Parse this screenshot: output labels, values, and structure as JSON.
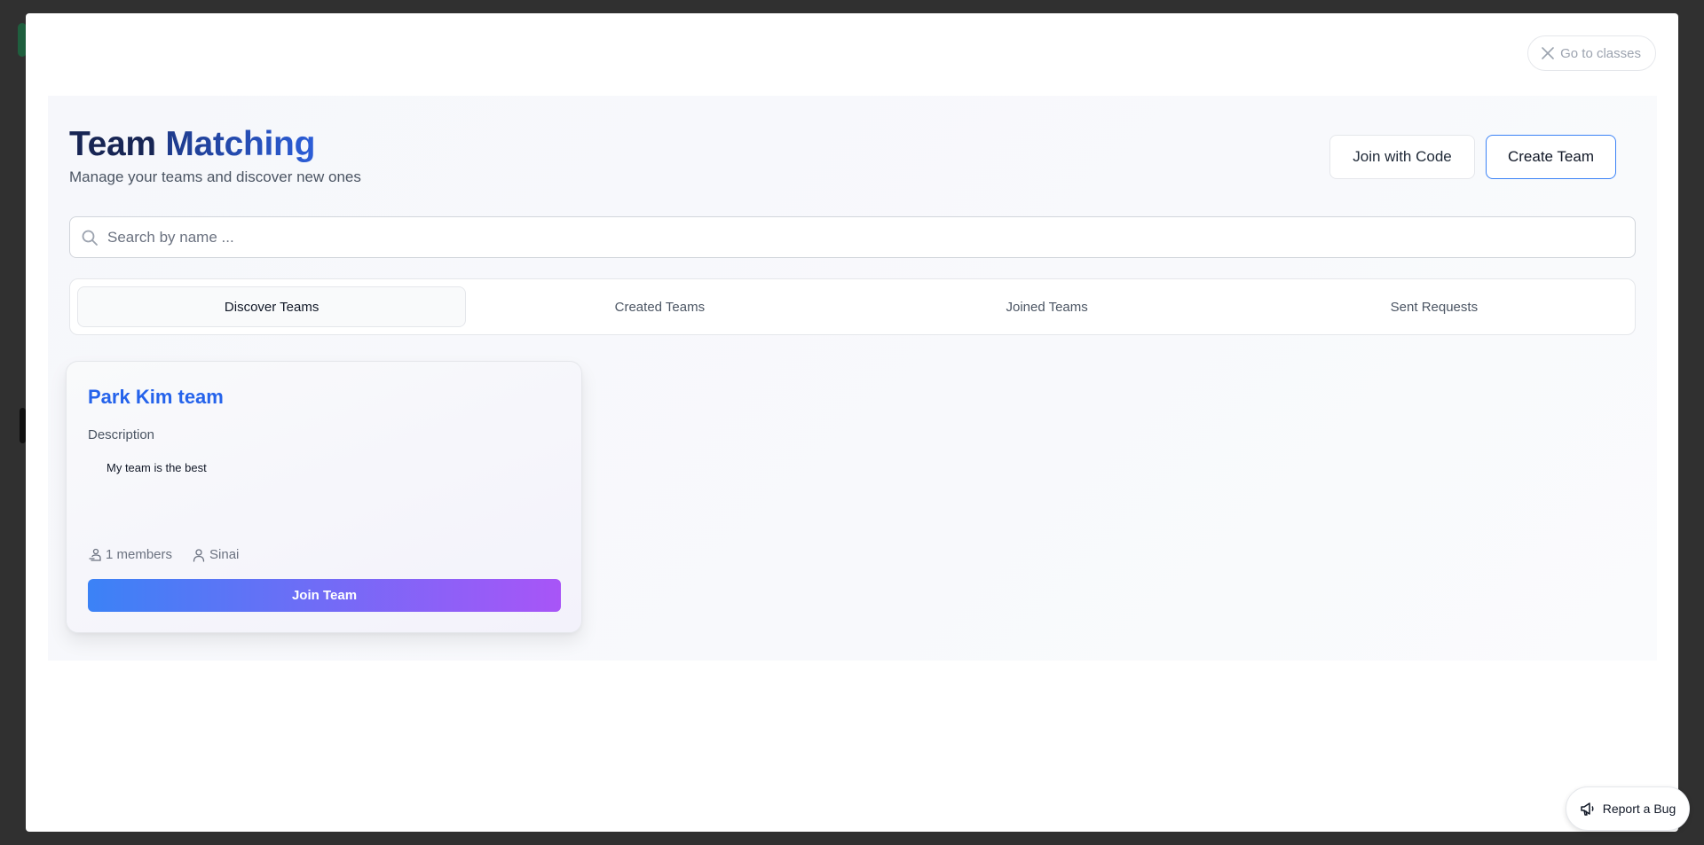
{
  "modal": {
    "close_label": "Go to classes"
  },
  "header": {
    "title_part1": "Team",
    "title_part2": "Matching",
    "subtitle": "Manage your teams and discover new ones",
    "join_code_label": "Join with Code",
    "create_team_label": "Create Team"
  },
  "search": {
    "placeholder": "Search by name ...",
    "value": ""
  },
  "tabs": [
    {
      "label": "Discover Teams",
      "active": true
    },
    {
      "label": "Created Teams",
      "active": false
    },
    {
      "label": "Joined Teams",
      "active": false
    },
    {
      "label": "Sent Requests",
      "active": false
    }
  ],
  "teams": [
    {
      "name": "Park Kim team",
      "description_label": "Description",
      "description": "My team is the best",
      "members": "1 members",
      "owner": "Sinai",
      "join_label": "Join Team"
    }
  ],
  "bug_report": {
    "label": "Report a Bug"
  },
  "colors": {
    "accent": "#2563eb",
    "gradient_start": "#3b82f6",
    "gradient_end": "#a855f7",
    "title_dark": "#172554"
  }
}
